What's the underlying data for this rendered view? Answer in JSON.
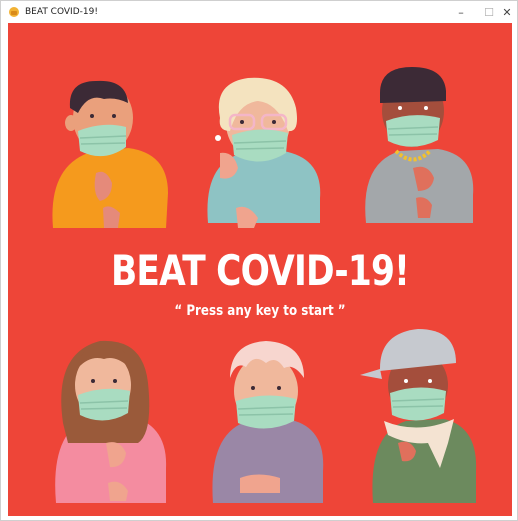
{
  "window": {
    "title": "BEAT COVID-19!",
    "controls": {
      "minimize": "–",
      "maximize": "☐",
      "close": "✕"
    }
  },
  "game": {
    "headline": "BEAT COVID-19!",
    "prompt": "“ Press any key to start ”",
    "background_color": "#ee4538",
    "characters": [
      "man-orange-shirt-masked",
      "elderly-woman-glasses-masked",
      "man-gold-chain-masked",
      "woman-pink-sweater-masked",
      "elderly-man-purple-sweater-masked",
      "man-cap-scarf-masked"
    ]
  }
}
